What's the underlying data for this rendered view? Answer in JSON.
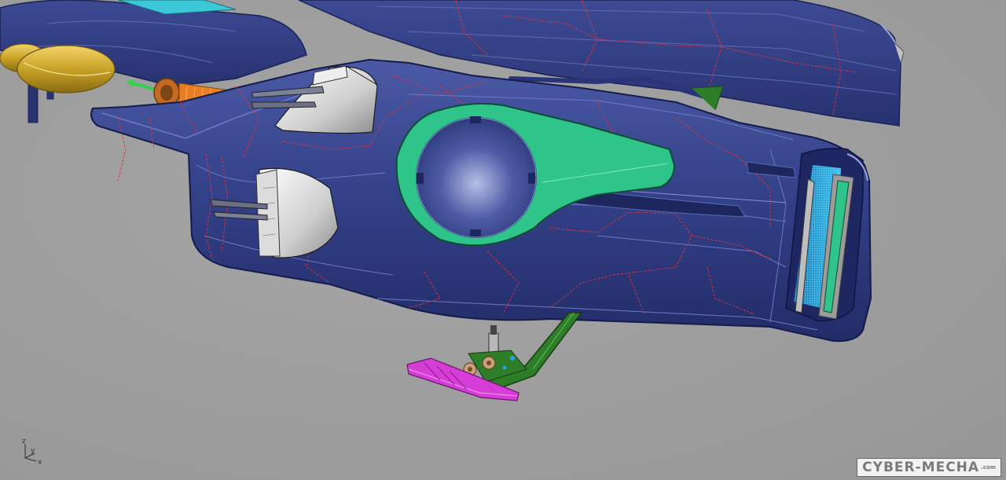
{
  "viewport": {
    "background": "#9c9c9c"
  },
  "axis_widget": {
    "z_label": "z",
    "y_label": "y",
    "x_label": "x"
  },
  "watermark": {
    "text": "CYBER-MECHA",
    "suffix": ".com"
  },
  "colors": {
    "hull": "#2e3b7e",
    "hull_light": "#4a5aa3",
    "seam_red": "#e0323c",
    "panel_green": "#2fc489",
    "bracket_green": "#2e7d28",
    "pedal_magenta": "#d63cd6",
    "engine_gold": "#c9a326",
    "copper": "#d2772b",
    "intake_blue": "#27a4e2",
    "fin_grey": "#d6d6d6"
  }
}
